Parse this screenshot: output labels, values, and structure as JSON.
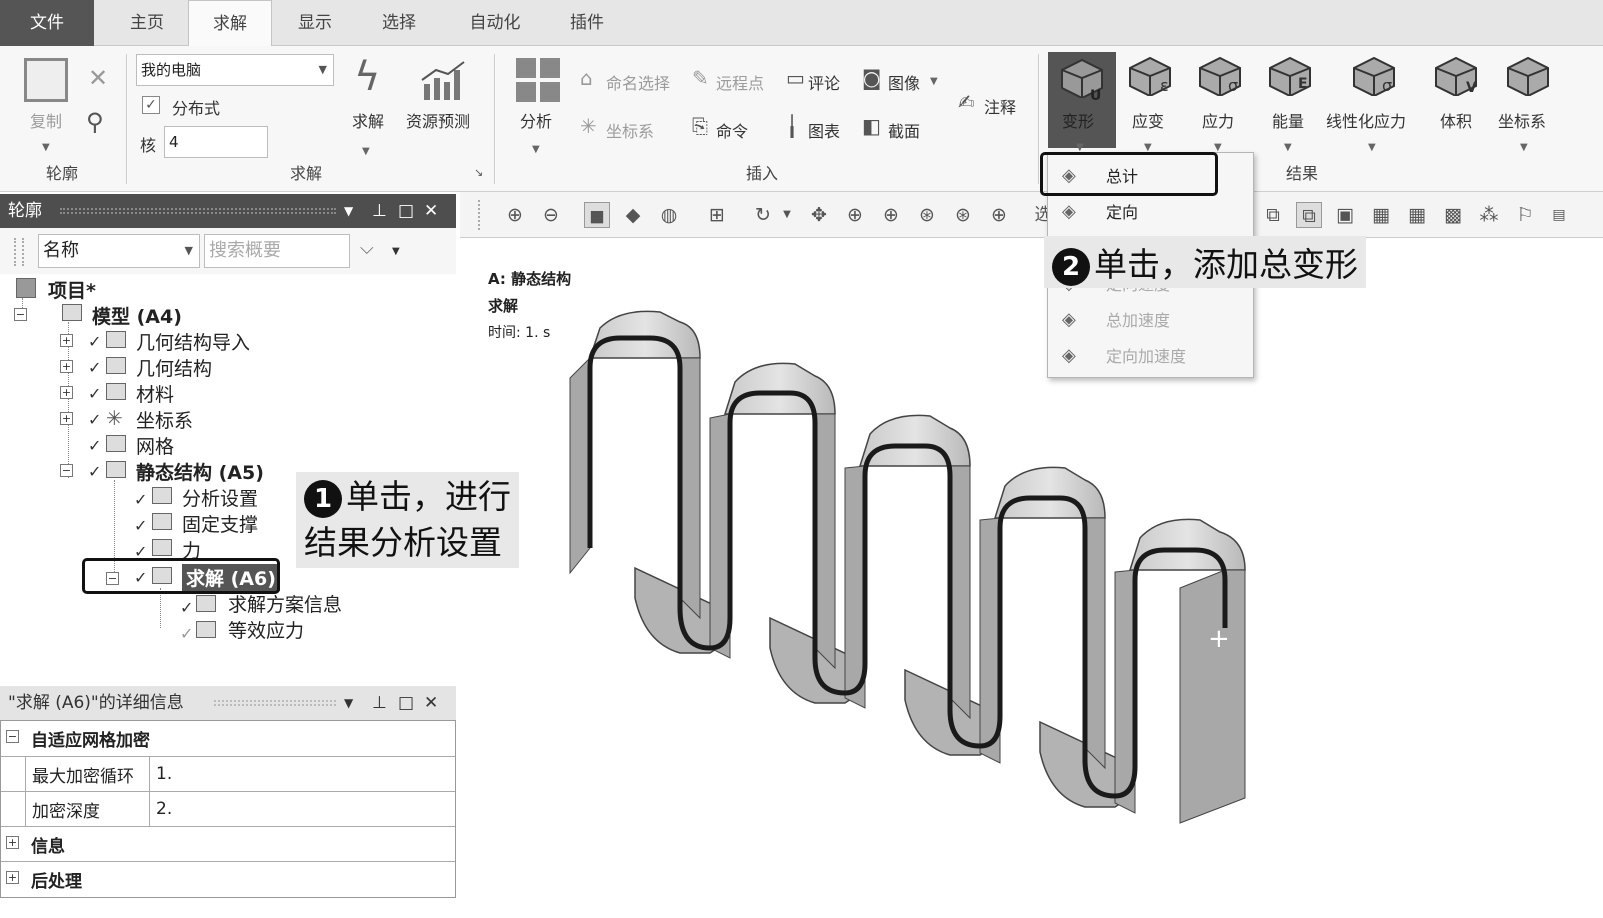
{
  "tabs": {
    "file": "文件",
    "home": "主页",
    "solve": "求解",
    "display": "显示",
    "select": "选择",
    "automation": "自动化",
    "plugins": "插件"
  },
  "ribbon": {
    "outline_group": {
      "copy": "复制",
      "label": "轮廓"
    },
    "solve_group": {
      "machine": "我的电脑",
      "distributed": "分布式",
      "cores_label": "核",
      "cores_value": "4",
      "solve_button": "求解",
      "resource_prediction": "资源预测",
      "label": "求解"
    },
    "insert_group": {
      "analysis": "分析",
      "named_selection": "命名选择",
      "remote_point": "远程点",
      "comment": "评论",
      "image": "图像",
      "coordinate_system": "坐标系",
      "command": "命令",
      "chart": "图表",
      "section": "截面",
      "annotation": "注释",
      "label": "插入"
    },
    "results_group": {
      "deformation": "变形",
      "strain": "应变",
      "stress": "应力",
      "energy": "能量",
      "linearized_stress": "线性化应力",
      "volume": "体积",
      "coordinate_system": "坐标系",
      "label": "结果",
      "icon_letters": {
        "deformation": "U",
        "strain": "ε",
        "stress": "σ",
        "energy": "E",
        "linearized_stress": "σ",
        "volume": "V"
      }
    }
  },
  "dropdown": {
    "total": "总计",
    "directional": "定向",
    "directional_velocity": "定向速度",
    "total_acceleration": "总加速度",
    "directional_acceleration": "定向加速度"
  },
  "outline_pane": {
    "title": "轮廓",
    "name_combo": "名称",
    "search_placeholder": "搜索概要",
    "tree": {
      "project": "项目*",
      "model": "模型 (A4)",
      "geometry_import": "几何结构导入",
      "geometry": "几何结构",
      "materials": "材料",
      "coordinate_systems": "坐标系",
      "mesh": "网格",
      "static_structural": "静态结构 (A5)",
      "analysis_settings": "分析设置",
      "fixed_support": "固定支撑",
      "force": "力",
      "solution": "求解 (A6)",
      "solution_information": "求解方案信息",
      "equivalent_stress": "等效应力"
    }
  },
  "details_pane": {
    "title": "\"求解 (A6)\"的详细信息",
    "sections": {
      "adaptive": "自适应网格加密",
      "info": "信息",
      "postprocessing": "后处理"
    },
    "rows": [
      {
        "label": "最大加密循环",
        "value": "1."
      },
      {
        "label": "加密深度",
        "value": "2."
      }
    ]
  },
  "viewport": {
    "title": "A: 静态结构",
    "subtitle": "求解",
    "time": "时间: 1. s",
    "toolbar_letter": "选",
    "cursor": "+"
  },
  "callouts": {
    "one_num": "1",
    "one_line1": "单击，进行",
    "one_line2": "结果分析设置",
    "two_num": "2",
    "two_text": "单击，添加总变形"
  }
}
